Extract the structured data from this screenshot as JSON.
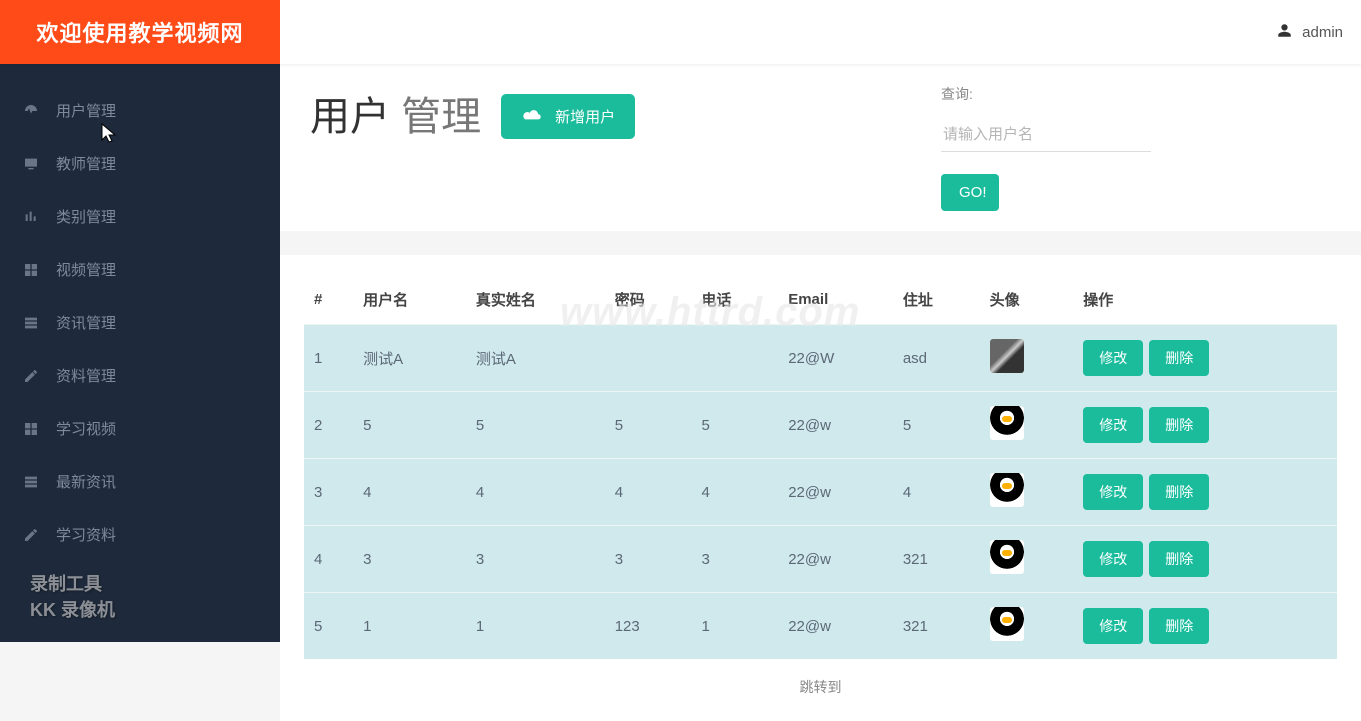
{
  "brand": "欢迎使用教学视频网",
  "header": {
    "username": "admin"
  },
  "sidebar": {
    "items": [
      {
        "label": "用户管理"
      },
      {
        "label": "教师管理"
      },
      {
        "label": "类别管理"
      },
      {
        "label": "视频管理"
      },
      {
        "label": "资讯管理"
      },
      {
        "label": "资料管理"
      },
      {
        "label": "学习视频"
      },
      {
        "label": "最新资讯"
      },
      {
        "label": "学习资料"
      }
    ],
    "watermark_line1": "录制工具",
    "watermark_line2": "KK 录像机"
  },
  "page": {
    "title_strong": "用户",
    "title_sub": "管理",
    "add_label": "新增用户",
    "search_label": "查询:",
    "search_placeholder": "请输入用户名",
    "go_label": "GO!",
    "jump_label": "跳转到"
  },
  "table": {
    "columns": [
      "#",
      "用户名",
      "真实姓名",
      "密码",
      "电话",
      "Email",
      "住址",
      "头像",
      "操作"
    ],
    "action_edit": "修改",
    "action_delete": "删除",
    "rows": [
      {
        "idx": "1",
        "username": "测试A",
        "realname": "测试A",
        "password": "",
        "phone": "",
        "email": "22@W",
        "address": "asd",
        "avatar": "dog"
      },
      {
        "idx": "2",
        "username": "5",
        "realname": "5",
        "password": "5",
        "phone": "5",
        "email": "22@w",
        "address": "5",
        "avatar": "penguin"
      },
      {
        "idx": "3",
        "username": "4",
        "realname": "4",
        "password": "4",
        "phone": "4",
        "email": "22@w",
        "address": "4",
        "avatar": "penguin"
      },
      {
        "idx": "4",
        "username": "3",
        "realname": "3",
        "password": "3",
        "phone": "3",
        "email": "22@w",
        "address": "321",
        "avatar": "penguin"
      },
      {
        "idx": "5",
        "username": "1",
        "realname": "1",
        "password": "123",
        "phone": "1",
        "email": "22@w",
        "address": "321",
        "avatar": "penguin"
      }
    ]
  },
  "center_watermark": "www.httrd.com"
}
